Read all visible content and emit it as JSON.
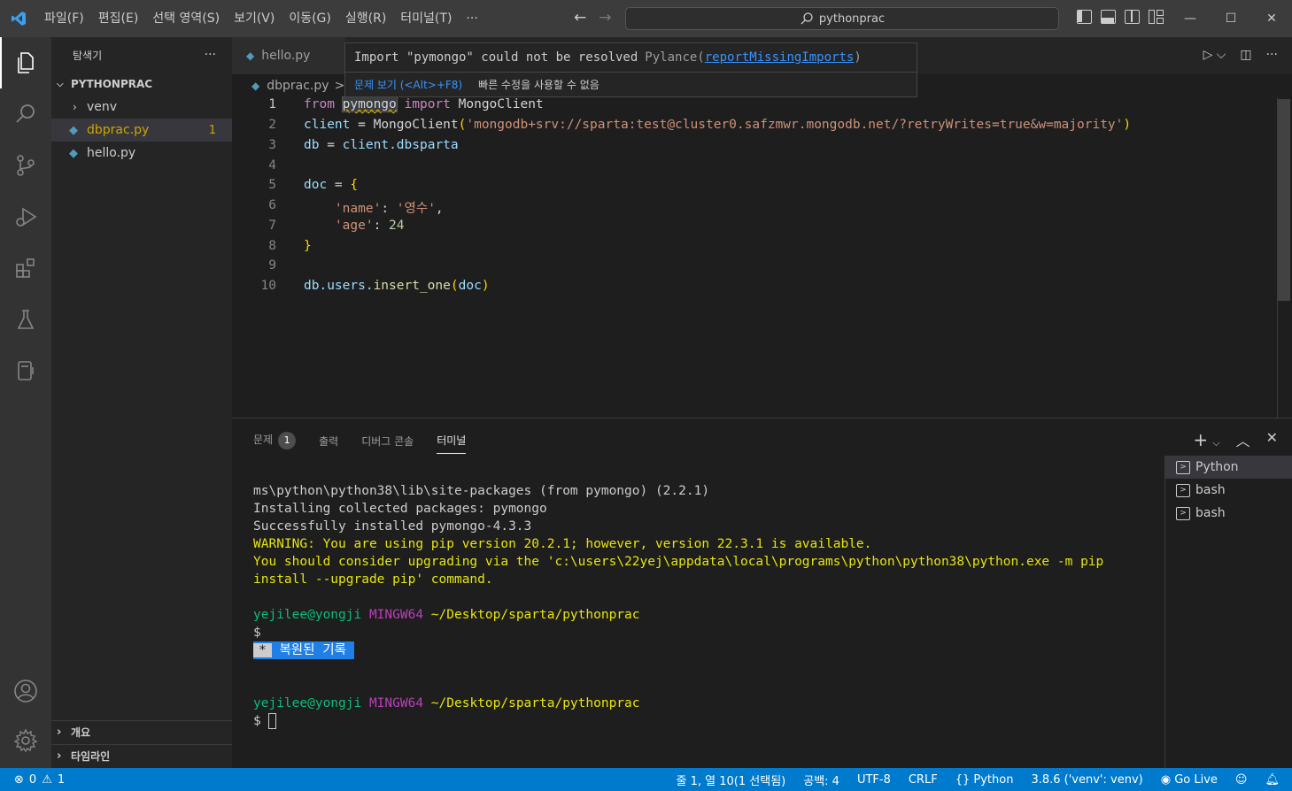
{
  "menu": [
    "파일(F)",
    "편집(E)",
    "선택 영역(S)",
    "보기(V)",
    "이동(G)",
    "실행(R)",
    "터미널(T)",
    "···"
  ],
  "command_center": {
    "label": "pythonprac"
  },
  "window_controls": {
    "minimize": "—",
    "maximize": "☐",
    "close": "✕"
  },
  "explorer": {
    "title": "탐색기",
    "more": "···",
    "project": "PYTHONPRAC",
    "items": [
      {
        "label": "venv",
        "type": "folder"
      },
      {
        "label": "dbprac.py",
        "type": "file",
        "badge": "1",
        "selected": true
      },
      {
        "label": "hello.py",
        "type": "file"
      }
    ],
    "outline": "개요",
    "timeline": "타임라인"
  },
  "editor": {
    "tab": "hello.py",
    "breadcrumb": "dbprac.py",
    "breadcrumb_sep": ">",
    "hover": {
      "message": "Import \"pymongo\" could not be resolved",
      "source": "Pylance(",
      "rule": "reportMissingImports",
      "source_end": ")",
      "view_problem": "문제 보기 (<Alt>+F8)",
      "no_quickfix": "빠른 수정을 사용할 수 없음"
    },
    "line_numbers": [
      "1",
      "2",
      "3",
      "4",
      "5",
      "6",
      "7",
      "8",
      "9",
      "10"
    ],
    "code": {
      "l1_from": "from",
      "l1_mod": "pymongo",
      "l1_import": "import",
      "l1_cls": "MongoClient",
      "l2_var": "client",
      "l2_eq": " = ",
      "l2_cls": "MongoClient",
      "l2_open": "(",
      "l2_str": "'mongodb+srv://sparta:test@cluster0.safzmwr.mongodb.net/?retryWrites=true&w=majority'",
      "l2_close": ")",
      "l3_var": "db",
      "l3_eq": " = ",
      "l3_obj": "client",
      "l3_attr": ".dbsparta",
      "l5_var": "doc",
      "l5_eq": " = ",
      "l5_open": "{",
      "l6_key": "'name'",
      "l6_colon": ": ",
      "l6_val": "'영수'",
      "l6_comma": ",",
      "l7_key": "'age'",
      "l7_colon": ": ",
      "l7_val": "24",
      "l8_close": "}",
      "l10_obj": "db",
      "l10_attr": ".users.",
      "l10_fn": "insert_one",
      "l10_open": "(",
      "l10_arg": "doc",
      "l10_close": ")"
    }
  },
  "panel": {
    "tabs": [
      "문제",
      "출력",
      "디버그 콘솔",
      "터미널"
    ],
    "problems_count": "1",
    "add": "+",
    "terminal_lines": [
      {
        "text": "ms\\python\\python38\\lib\\site-packages (from pymongo) (2.2.1)",
        "color": "w"
      },
      {
        "text": "Installing collected packages: pymongo",
        "color": "w"
      },
      {
        "text": "Successfully installed pymongo-4.3.3",
        "color": "w"
      },
      {
        "text": "WARNING: You are using pip version 20.2.1; however, version 22.3.1 is available.",
        "color": "y"
      },
      {
        "text": "You should consider upgrading via the 'c:\\users\\22yej\\appdata\\local\\programs\\python\\python38\\python.exe -m pip",
        "color": "y"
      },
      {
        "text": "install --upgrade pip' command.",
        "color": "y"
      }
    ],
    "prompt_user": "yejilee@yongji",
    "prompt_shell": "MINGW64",
    "prompt_path": "~/Desktop/sparta/pythonprac",
    "dollar": "$",
    "restored_star": "*",
    "restored_label": " 복원된 기록 ",
    "terminals": [
      "Python",
      "bash",
      "bash"
    ]
  },
  "statusbar": {
    "errors": "0",
    "warnings": "1",
    "position": "줄 1, 열 10(1 선택됨)",
    "spaces": "공백: 4",
    "encoding": "UTF-8",
    "eol": "CRLF",
    "language": "Python",
    "interpreter": "3.8.6 ('venv': venv)",
    "golive": "Go Live"
  },
  "colors": {
    "accent": "#007acc",
    "warning": "#cca700",
    "terminal_green": "#0dbc79",
    "terminal_magenta": "#bc3fbc",
    "terminal_yellow": "#e5e510"
  }
}
